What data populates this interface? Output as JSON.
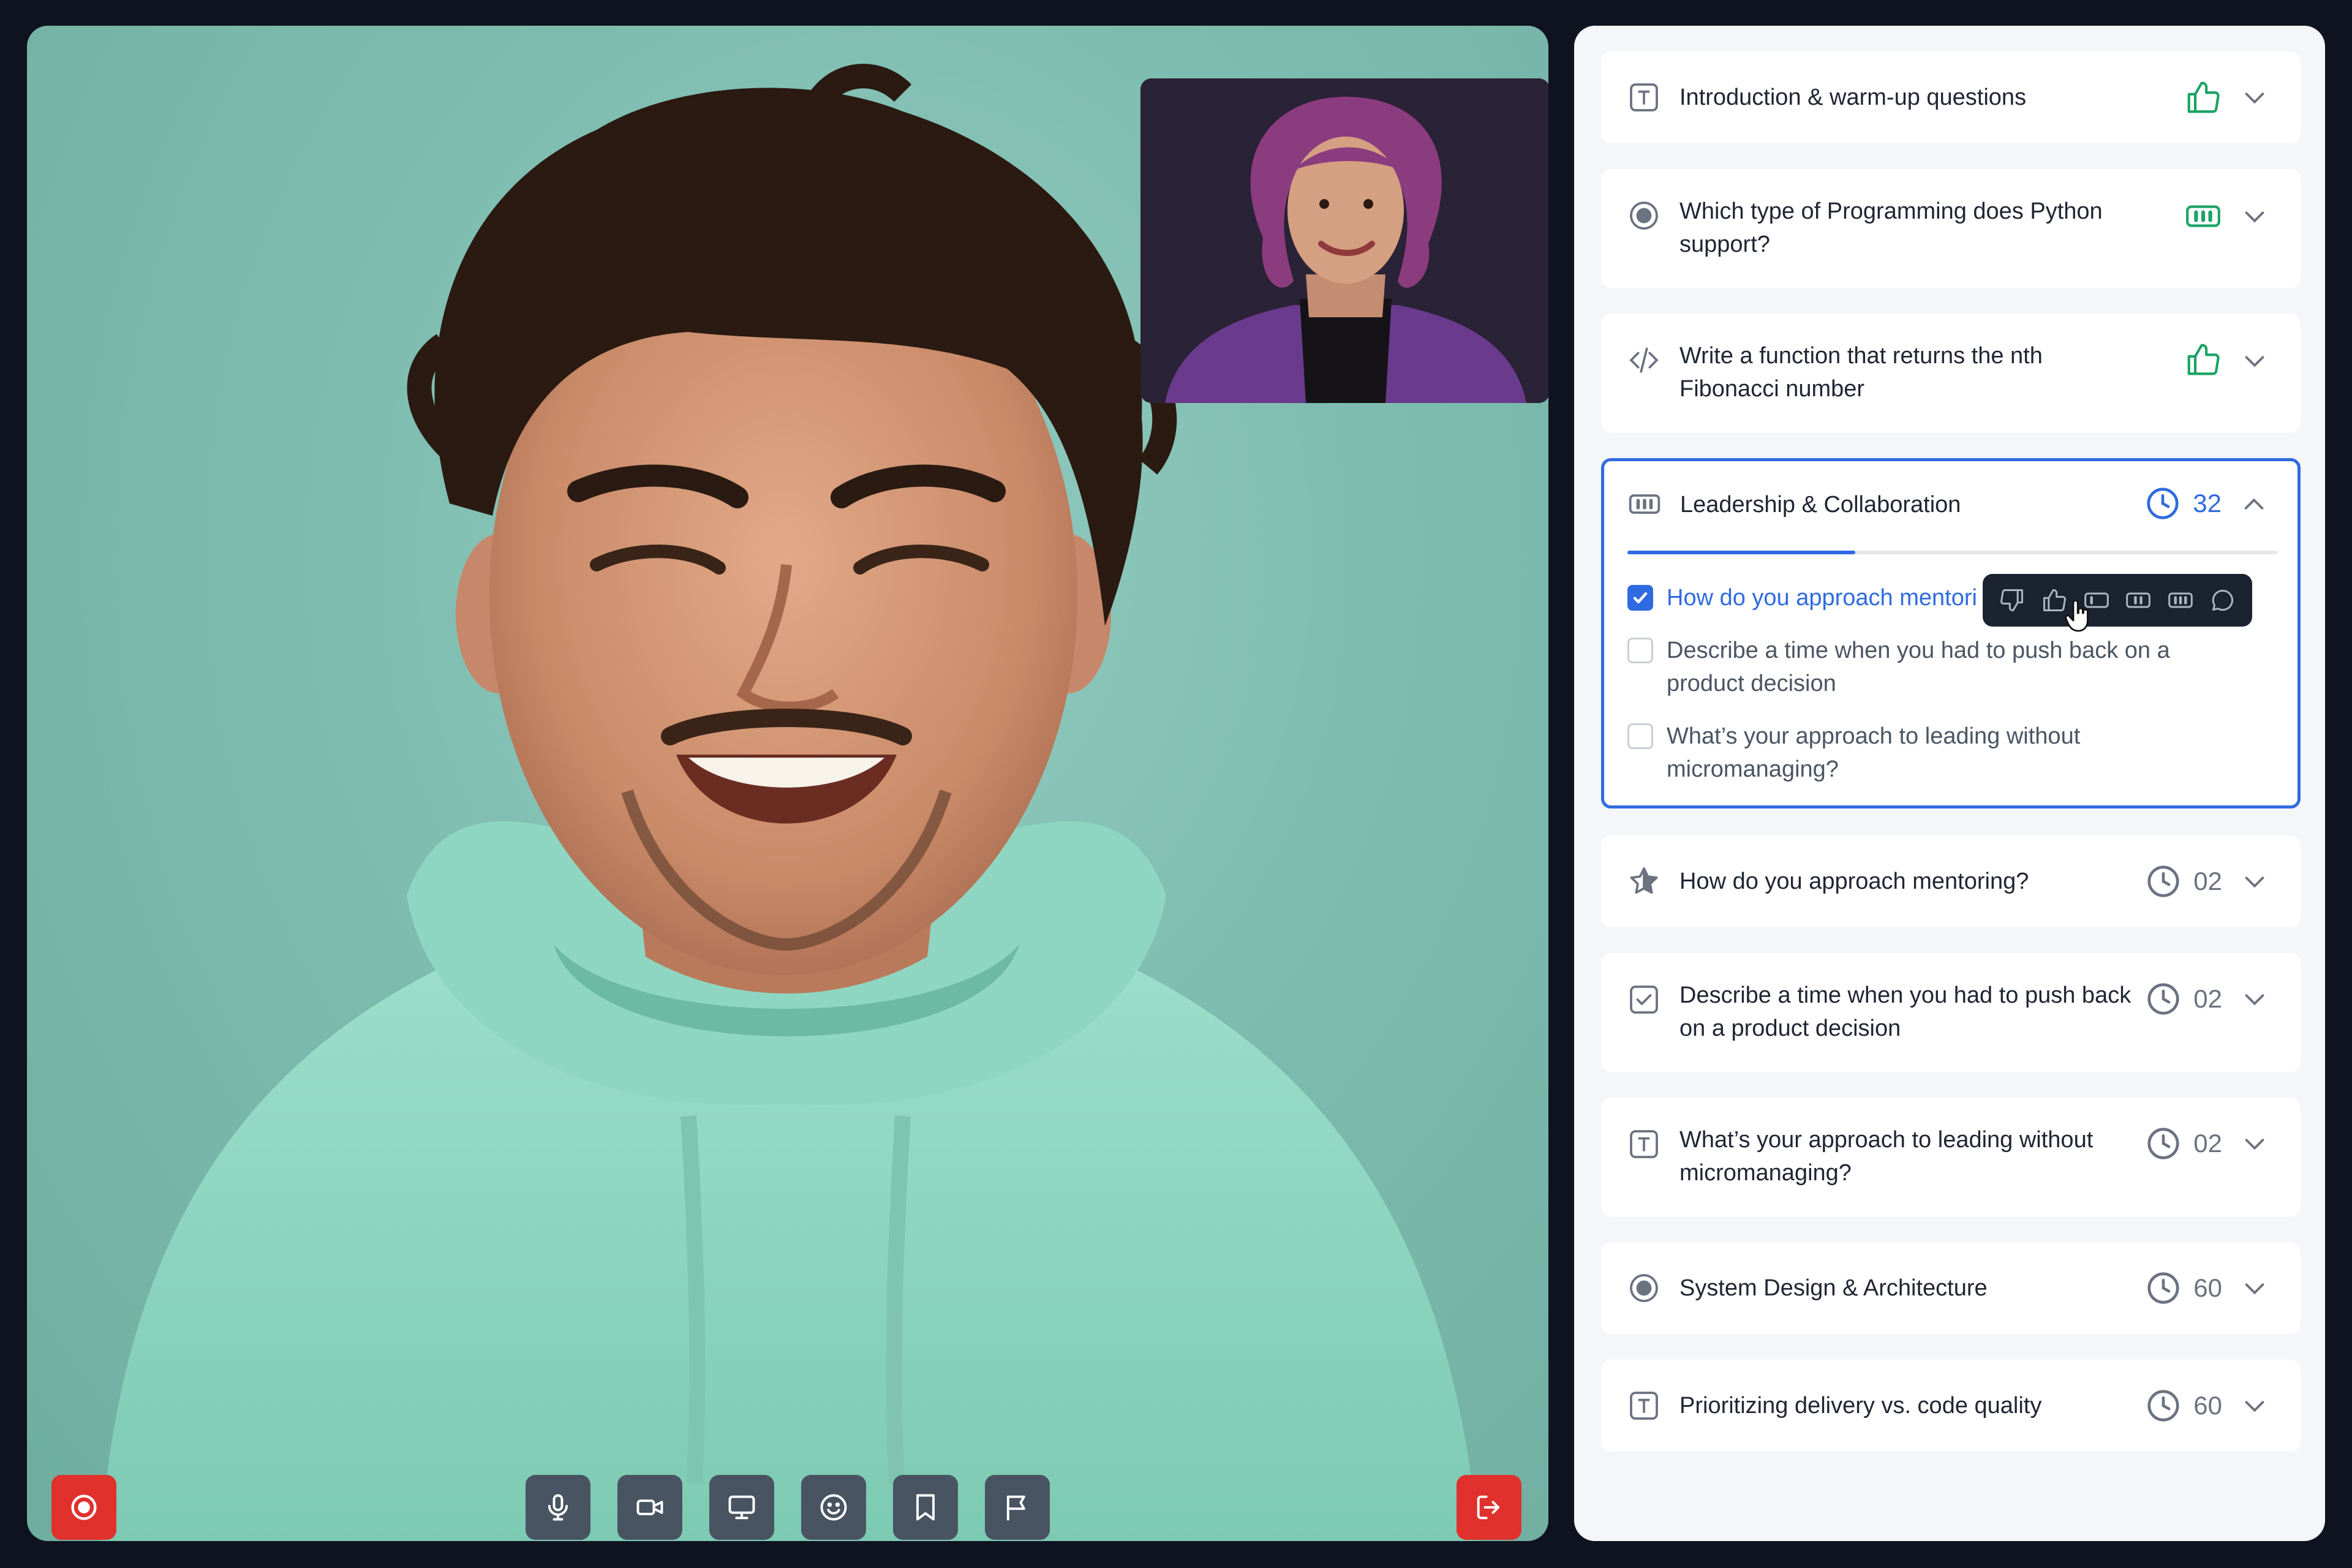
{
  "colors": {
    "accent": "#2f6be0",
    "success": "#1aa364",
    "danger": "#e0312d",
    "control_bg": "#495462",
    "panel_bg": "#f4f6f9",
    "page_bg": "#0f1320"
  },
  "controls": {
    "record_icon": "record-icon",
    "buttons": [
      "mic-icon",
      "camera-icon",
      "screen-share-icon",
      "emoji-icon",
      "bookmark-icon",
      "flag-icon"
    ],
    "leave_icon": "leave-icon"
  },
  "questions": [
    {
      "title": "Introduction & warm-up questions",
      "type_icon": "text-icon",
      "status": "thumbs-up",
      "expanded": false
    },
    {
      "title": "Which type of Programming does Python support?",
      "type_icon": "radio-icon",
      "status": "rating-3",
      "expanded": false
    },
    {
      "title": "Write a function that returns the nth Fibonacci number",
      "type_icon": "code-icon",
      "status": "thumbs-up",
      "expanded": false
    },
    {
      "title": "Leadership & Collaboration",
      "type_icon": "rating-icon",
      "status": "timer",
      "count": "32",
      "expanded": true,
      "progress": 0.35,
      "subquestions": [
        {
          "text": "How do you approach mentori",
          "checked": true
        },
        {
          "text": "Describe a time when you had to push back on a product decision",
          "checked": false
        },
        {
          "text": "What’s your approach to leading without micromanaging?",
          "checked": false
        }
      ],
      "rating_toolbar": [
        "thumbs-down-icon",
        "thumbs-up-icon",
        "rating-1-icon",
        "rating-2-icon",
        "rating-3-icon",
        "comment-icon"
      ]
    },
    {
      "title": "How do you approach mentoring?",
      "type_icon": "star-icon",
      "status": "timer",
      "count": "02",
      "expanded": false
    },
    {
      "title": "Describe a time when you had to push back on a product decision",
      "type_icon": "checkbox-icon",
      "status": "timer",
      "count": "02",
      "expanded": false
    },
    {
      "title": "What’s your approach to leading without micromanaging?",
      "type_icon": "text-icon",
      "status": "timer",
      "count": "02",
      "expanded": false
    },
    {
      "title": "System Design & Architecture",
      "type_icon": "radio-icon",
      "status": "timer",
      "count": "60",
      "expanded": false
    },
    {
      "title": "Prioritizing delivery vs. code quality",
      "type_icon": "text-icon",
      "status": "timer",
      "count": "60",
      "expanded": false
    }
  ]
}
